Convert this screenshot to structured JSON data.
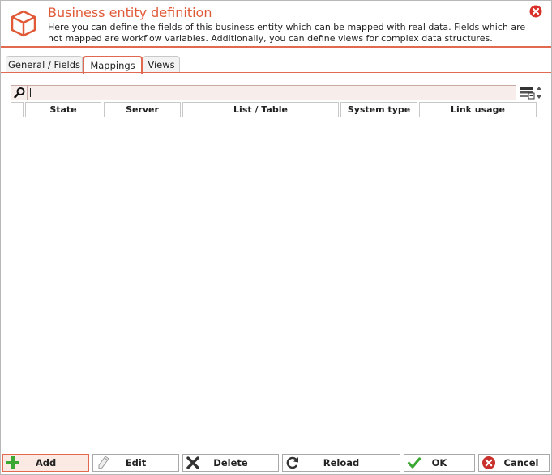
{
  "header": {
    "title": "Business entity definition",
    "description": "Here you can define the fields of this business entity which can be mapped with real data. Fields which are not mapped are workflow variables. Additionally, you can define views for complex data structures."
  },
  "tabs": [
    {
      "label": "General / Fields",
      "active": false
    },
    {
      "label": "Mappings",
      "active": true
    },
    {
      "label": "Views",
      "active": false
    }
  ],
  "search": {
    "value": ""
  },
  "grid": {
    "columns": [
      "State",
      "Server",
      "List / Table",
      "System type",
      "Link usage"
    ],
    "rows": []
  },
  "buttons": {
    "add": "Add",
    "edit": "Edit",
    "delete": "Delete",
    "reload": "Reload",
    "ok": "OK",
    "cancel": "Cancel"
  },
  "colors": {
    "accent": "#e0694f",
    "title": "#e05a37",
    "add_icon": "#3aa832",
    "ok_icon": "#3aa832",
    "cancel_icon": "#c8302b"
  }
}
